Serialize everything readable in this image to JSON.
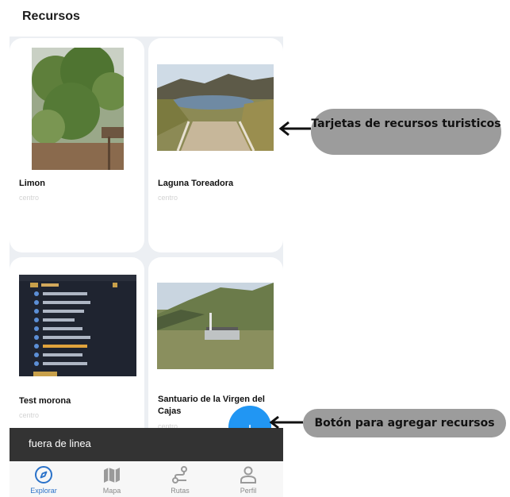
{
  "header": {
    "title": "Recursos"
  },
  "cards": [
    {
      "title": "Limon",
      "subtitle": "centro",
      "image": "plant-garden-photo"
    },
    {
      "title": "Laguna Toreadora",
      "subtitle": "centro",
      "image": "lagoon-landscape-photo"
    },
    {
      "title": "Test morona",
      "subtitle": "centro",
      "image": "code-editor-screenshot"
    },
    {
      "title": "Santuario de la Virgen del Cajas",
      "subtitle": "centro",
      "image": "mountain-valley-photo"
    }
  ],
  "snackbar": {
    "text": "fuera de linea"
  },
  "fab": {
    "icon": "plus-icon",
    "label": "+"
  },
  "bottom_nav": {
    "items": [
      {
        "label": "Explorar",
        "icon": "compass-icon",
        "active": true
      },
      {
        "label": "Mapa",
        "icon": "map-icon",
        "active": false
      },
      {
        "label": "Rutas",
        "icon": "route-icon",
        "active": false
      },
      {
        "label": "Perfil",
        "icon": "person-icon",
        "active": false
      }
    ]
  },
  "annotations": [
    {
      "text": "Tarjetas de recursos turisticos"
    },
    {
      "text": "Botón para agregar recursos"
    }
  ],
  "colors": {
    "accent": "#2196f3",
    "active_nav": "#2a72c9",
    "snackbar_bg": "#333333",
    "callout_bg": "#9c9c9c"
  }
}
